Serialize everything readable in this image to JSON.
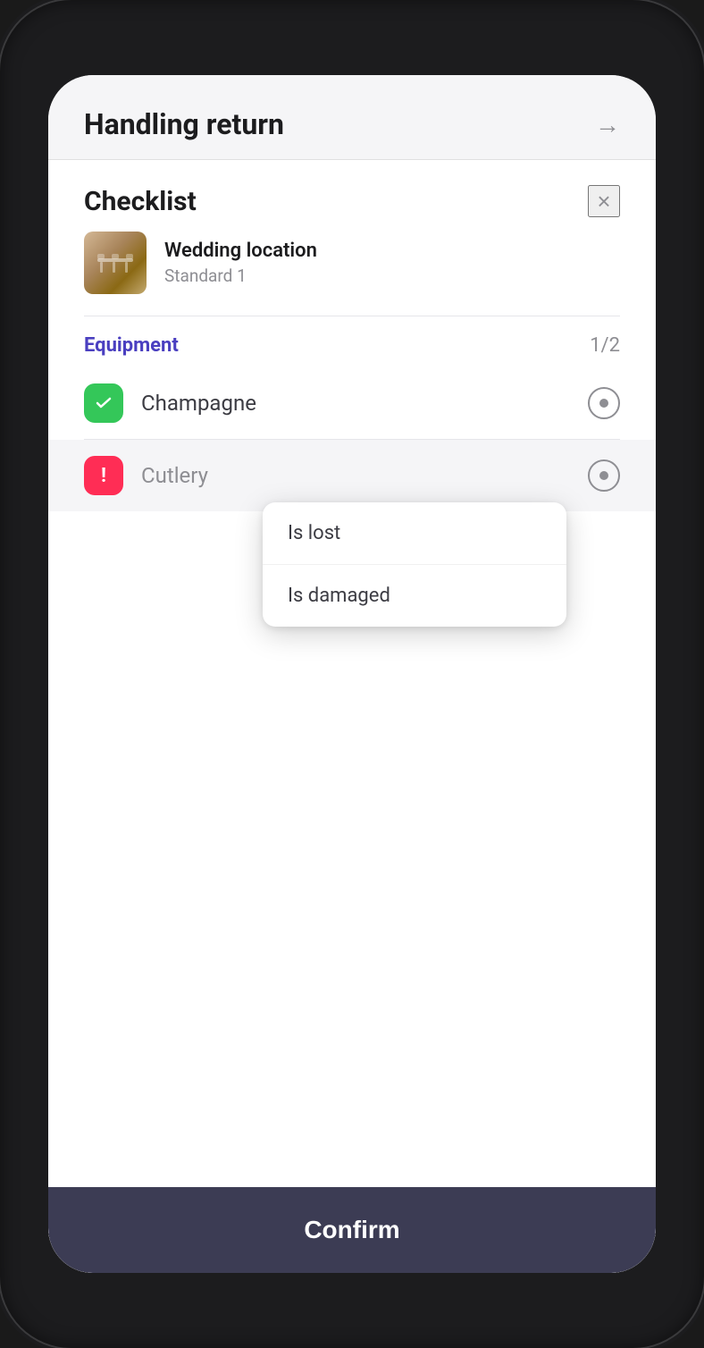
{
  "header": {
    "title": "Handling return",
    "arrow_label": "→"
  },
  "checklist": {
    "title": "Checklist",
    "close_label": "×"
  },
  "location": {
    "name": "Wedding location",
    "subtitle": "Standard 1"
  },
  "equipment": {
    "label": "Equipment",
    "count": "1/2",
    "items": [
      {
        "name": "Champagne",
        "status": "checked",
        "icon_type": "check"
      },
      {
        "name": "Cutlery",
        "status": "alert",
        "icon_type": "alert"
      }
    ]
  },
  "dropdown": {
    "items": [
      {
        "label": "Is lost"
      },
      {
        "label": "Is damaged"
      }
    ]
  },
  "footer": {
    "confirm_label": "Confirm"
  },
  "icons": {
    "checkmark": "✓",
    "exclamation": "!",
    "close": "×",
    "arrow_right": "→"
  }
}
